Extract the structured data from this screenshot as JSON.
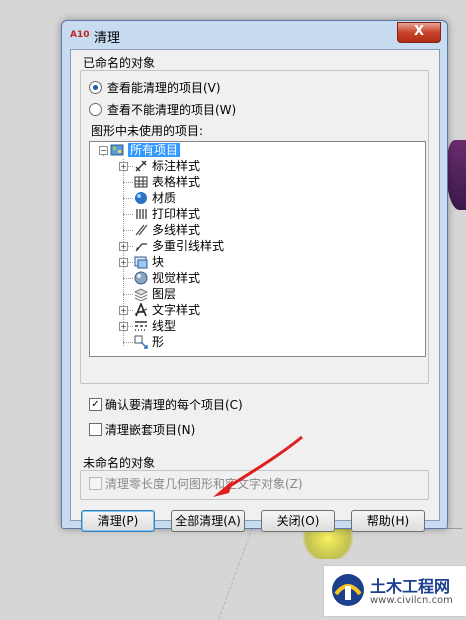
{
  "window": {
    "title": "清理",
    "app_icon_text": "A10",
    "close_glyph": "X"
  },
  "named_group": {
    "title": "已命名的对象",
    "radio_view_purgeable": "查看能清理的项目(V)",
    "radio_view_nonpurgeable": "查看不能清理的项目(W)",
    "tree_caption": "图形中未使用的项目:"
  },
  "tree": {
    "root": "所有项目",
    "items": [
      "标注样式",
      "表格样式",
      "材质",
      "打印样式",
      "多线样式",
      "多重引线样式",
      "块",
      "视觉样式",
      "图层",
      "文字样式",
      "线型",
      "形"
    ]
  },
  "options": {
    "confirm_each": "确认要清理的每个项目(C)",
    "purge_nested": "清理嵌套项目(N)"
  },
  "unnamed_group": {
    "title": "未命名的对象",
    "zero_length": "清理零长度几何图形和空文字对象(Z)"
  },
  "buttons": {
    "purge": "清理(P)",
    "purge_all": "全部清理(A)",
    "close": "关闭(O)",
    "help": "帮助(H)"
  },
  "watermark": {
    "name": "土木工程网",
    "url": "www.civilcn.com"
  },
  "colors": {
    "selection": "#3399ff",
    "arrow": "#e02020",
    "title_bar": "#c7dbf1"
  }
}
